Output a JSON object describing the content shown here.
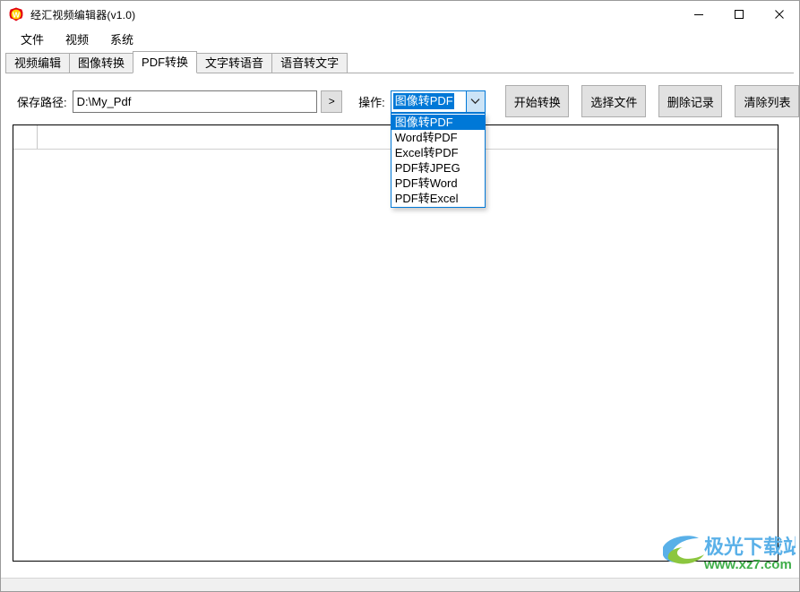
{
  "window": {
    "title": "经汇视频编辑器(v1.0)",
    "icon": "app-logo-w-icon",
    "controls": {
      "minimize": "minimize-icon",
      "maximize": "maximize-icon",
      "close": "close-icon"
    }
  },
  "menubar": {
    "items": [
      {
        "label": "文件"
      },
      {
        "label": "视频"
      },
      {
        "label": "系统"
      }
    ]
  },
  "tabs": {
    "active_index": 2,
    "items": [
      {
        "label": "视频编辑"
      },
      {
        "label": "图像转换"
      },
      {
        "label": "PDF转换"
      },
      {
        "label": "文字转语音"
      },
      {
        "label": "语音转文字"
      }
    ]
  },
  "toolbar": {
    "path_label": "保存路径:",
    "path_value": "D:\\My_Pdf",
    "path_placeholder": "",
    "browse_label": ">",
    "operation_label": "操作:",
    "operation_selected": "图像转PDF",
    "operation_options": [
      "图像转PDF",
      "Word转PDF",
      "Excel转PDF",
      "PDF转JPEG",
      "PDF转Word",
      "PDF转Excel"
    ],
    "dropdown_open": true,
    "caret_icon": "chevron-down-icon",
    "buttons": [
      {
        "name": "start-convert-button",
        "label": "开始转换"
      },
      {
        "name": "choose-file-button",
        "label": "选择文件"
      },
      {
        "name": "delete-record-button",
        "label": "删除记录"
      },
      {
        "name": "clear-list-button",
        "label": "清除列表"
      }
    ]
  },
  "grid": {
    "columns": [
      "",
      ""
    ],
    "rows": []
  },
  "watermark": {
    "brand": "极光下载站",
    "url": "www.xz7.com"
  },
  "colors": {
    "accent": "#0078d7",
    "combo_caret_bg": "#cce4f7",
    "button_face": "#e1e1e1",
    "tab_inactive": "#f0f0f0",
    "window_border": "#9a9a9a",
    "watermark_brand": "#59b0e8",
    "watermark_url": "#3fae49",
    "icon_red": "#e3000f",
    "icon_yellow": "#ffd200"
  }
}
